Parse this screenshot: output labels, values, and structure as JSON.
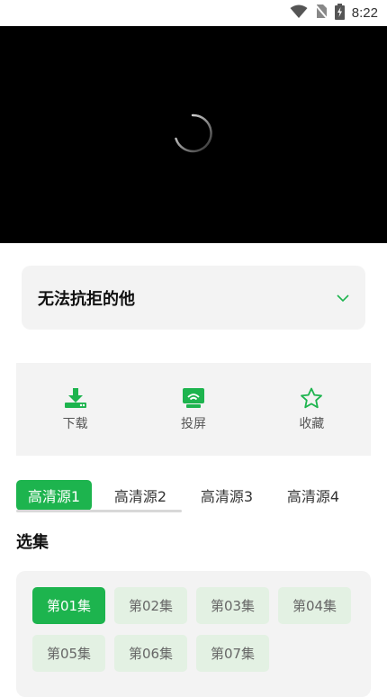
{
  "status_bar": {
    "time": "8:22"
  },
  "video": {
    "state_icon": "loading-spinner-icon"
  },
  "title_card": {
    "title": "无法抗拒的他"
  },
  "actions": [
    {
      "label": "下载",
      "icon": "download-icon"
    },
    {
      "label": "投屏",
      "icon": "cast-screen-icon"
    },
    {
      "label": "收藏",
      "icon": "star-icon"
    }
  ],
  "sources": [
    {
      "label": "高清源1",
      "active": true
    },
    {
      "label": "高清源2",
      "active": false
    },
    {
      "label": "高清源3",
      "active": false
    },
    {
      "label": "高清源4",
      "active": false
    }
  ],
  "episodes_title": "选集",
  "episodes": [
    {
      "label": "第01集",
      "active": true
    },
    {
      "label": "第02集",
      "active": false
    },
    {
      "label": "第03集",
      "active": false
    },
    {
      "label": "第04集",
      "active": false
    },
    {
      "label": "第05集",
      "active": false
    },
    {
      "label": "第06集",
      "active": false
    },
    {
      "label": "第07集",
      "active": false
    }
  ],
  "colors": {
    "accent": "#1db44e",
    "episode_bg": "#e3f1e3",
    "card_bg": "#f3f3f3"
  }
}
